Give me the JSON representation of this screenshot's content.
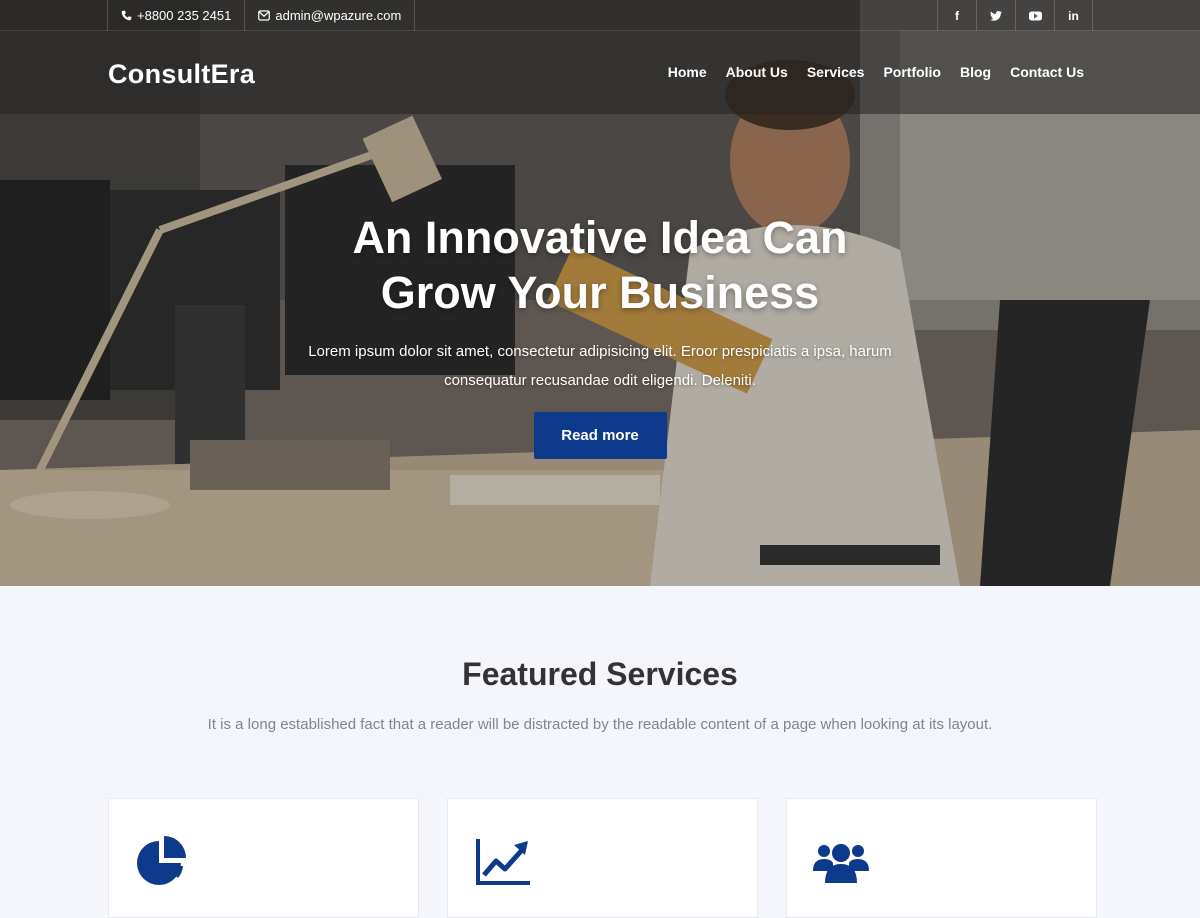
{
  "topbar": {
    "phone": "+8800 235 2451",
    "email": "admin@wpazure.com",
    "socials": [
      {
        "icon": "facebook-icon",
        "glyph": "f"
      },
      {
        "icon": "twitter-icon",
        "glyph": "t"
      },
      {
        "icon": "youtube-icon",
        "glyph": "▶"
      },
      {
        "icon": "linkedin-icon",
        "glyph": "in"
      }
    ]
  },
  "nav": {
    "logo": "ConsultEra",
    "items": [
      "Home",
      "About Us",
      "Services",
      "Portfolio",
      "Blog",
      "Contact Us"
    ]
  },
  "hero": {
    "title": "An Innovative Idea Can Grow Your Business",
    "subtitle": "Lorem ipsum dolor sit amet, consectetur adipisicing elit. Eroor prespiciatis a ipsa, harum consequatur recusandae odit eligendi. Deleniti.",
    "button": "Read more"
  },
  "featured": {
    "title": "Featured Services",
    "subtitle": "It is a long established fact that a reader will be distracted by the readable content of a page when looking at its layout.",
    "cards": [
      {
        "icon": "pie-chart-icon"
      },
      {
        "icon": "line-chart-icon"
      },
      {
        "icon": "users-icon"
      }
    ]
  },
  "colors": {
    "accent": "#0d3a8a",
    "icon": "#0d3a8a"
  }
}
